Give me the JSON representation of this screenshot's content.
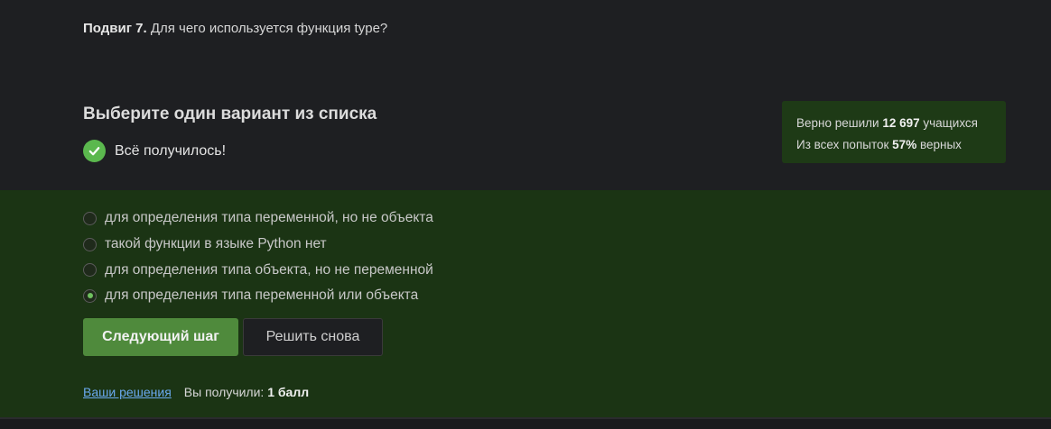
{
  "question": {
    "label": "Подвиг 7.",
    "text": "Для чего используется функция type?"
  },
  "choose_title": "Выберите один вариант из списка",
  "result": {
    "text": "Всё получилось!"
  },
  "stats": {
    "line1_prefix": "Верно решили",
    "line1_value": "12 697",
    "line1_suffix": "учащихся",
    "line2_prefix": "Из всех попыток",
    "line2_value": "57%",
    "line2_suffix": "верных"
  },
  "options": [
    {
      "label": "для определения типа переменной, но не объекта",
      "selected": false
    },
    {
      "label": "такой функции в языке Python нет",
      "selected": false
    },
    {
      "label": "для определения типа объекта, но не переменной",
      "selected": false
    },
    {
      "label": "для определения типа переменной или объекта",
      "selected": true
    }
  ],
  "buttons": {
    "next": "Следующий шаг",
    "retry": "Решить снова"
  },
  "footer": {
    "solutions_link": "Ваши решения",
    "score_prefix": "Вы получили:",
    "score_value": "1 балл"
  },
  "colors": {
    "accent_green": "#4f8a3c",
    "panel_green": "#1b3414",
    "check_green": "#5bb84e",
    "link_blue": "#6aa9ef"
  }
}
